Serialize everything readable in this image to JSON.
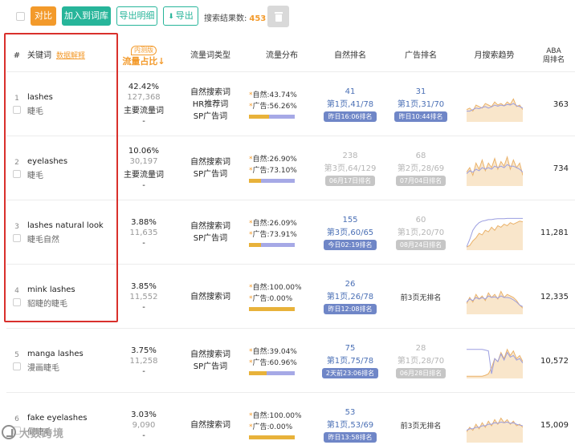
{
  "toolbar": {
    "compare_label": "对比",
    "add_label": "加入到词库",
    "export_detail_label": "导出明细",
    "export_label": "导出",
    "result_label": "搜索结果数:",
    "result_count": "453"
  },
  "header": {
    "num": "#",
    "keyword": "关键词",
    "data_explain": "数据解释",
    "share_badge": "内测版",
    "share_title": "流量占比↓",
    "type": "流量词类型",
    "dist": "流量分布",
    "natural_rank": "自然排名",
    "ad_rank": "广告排名",
    "trend": "月搜索趋势",
    "aba_line1": "ABA",
    "aba_line2": "周排名"
  },
  "labels": {
    "natural_prefix": "自然:",
    "ad_prefix": "广告:",
    "no_rank": "前3页无排名"
  },
  "colors": {
    "accent_orange": "#f39a2b",
    "accent_green": "#27b59a",
    "bar_natural": "#e8b23a",
    "bar_ad": "#a6a9e6",
    "rank_blue": "#4a6fb5",
    "highlight_red": "#d9302c"
  },
  "rows": [
    {
      "num": "1",
      "keyword": "lashes",
      "keyword_zh": "睫毛",
      "share_pct": "42.42%",
      "share_volume": "127,368",
      "share_tag": "主要流量词",
      "share_dash": "-",
      "types": [
        "自然搜索词",
        "HR推荐词",
        "SP广告词"
      ],
      "dist_natural": "43.74%",
      "dist_ad": "56.26%",
      "dist_natural_value": 43.74,
      "natural_rank": {
        "style": "blue",
        "num": "41",
        "page": "第1页,41/78",
        "badge": "昨日16:06排名"
      },
      "ad_rank": {
        "style": "blue",
        "num": "31",
        "page": "第1页,31/70",
        "badge": "昨日10:44排名"
      },
      "trend": [
        0.35,
        0.4,
        0.3,
        0.5,
        0.45,
        0.4,
        0.55,
        0.5,
        0.45,
        0.6,
        0.5,
        0.55,
        0.48,
        0.6,
        0.52,
        0.7,
        0.45,
        0.5,
        0.35
      ],
      "trend2": [
        0.3,
        0.3,
        0.35,
        0.4,
        0.38,
        0.42,
        0.45,
        0.4,
        0.44,
        0.5,
        0.46,
        0.5,
        0.47,
        0.52,
        0.5,
        0.55,
        0.48,
        0.45,
        0.4
      ],
      "aba": "363"
    },
    {
      "num": "2",
      "keyword": "eyelashes",
      "keyword_zh": "睫毛",
      "share_pct": "10.06%",
      "share_volume": "30,197",
      "share_tag": "主要流量词",
      "share_dash": "-",
      "types": [
        "自然搜索词",
        "SP广告词"
      ],
      "dist_natural": "26.90%",
      "dist_ad": "73.10%",
      "dist_natural_value": 26.9,
      "natural_rank": {
        "style": "grey",
        "num": "238",
        "page": "第3页,64/129",
        "badge": "06月17日排名"
      },
      "ad_rank": {
        "style": "grey",
        "num": "68",
        "page": "第2页,28/69",
        "badge": "07月04日排名"
      },
      "trend": [
        0.4,
        0.55,
        0.3,
        0.7,
        0.5,
        0.8,
        0.45,
        0.7,
        0.55,
        0.85,
        0.5,
        0.75,
        0.6,
        0.9,
        0.5,
        0.8,
        0.55,
        0.7,
        0.3
      ],
      "trend2": [
        0.35,
        0.45,
        0.4,
        0.5,
        0.45,
        0.55,
        0.5,
        0.55,
        0.5,
        0.6,
        0.55,
        0.6,
        0.55,
        0.65,
        0.6,
        0.6,
        0.55,
        0.5,
        0.4
      ],
      "aba": "734"
    },
    {
      "num": "3",
      "keyword": "lashes natural look",
      "keyword_zh": "睫毛自然",
      "share_pct": "3.88%",
      "share_volume": "11,635",
      "share_tag": "",
      "share_dash": "-",
      "types": [
        "自然搜索词",
        "SP广告词"
      ],
      "dist_natural": "26.09%",
      "dist_ad": "73.91%",
      "dist_natural_value": 26.09,
      "natural_rank": {
        "style": "blue",
        "num": "155",
        "page": "第3页,60/65",
        "badge": "今日02:19排名"
      },
      "ad_rank": {
        "style": "grey",
        "num": "60",
        "page": "第1页,20/70",
        "badge": "08月24日排名"
      },
      "trend": [
        0.05,
        0.1,
        0.25,
        0.35,
        0.5,
        0.45,
        0.6,
        0.55,
        0.7,
        0.6,
        0.75,
        0.7,
        0.8,
        0.75,
        0.85,
        0.8,
        0.85,
        0.9,
        0.88
      ],
      "trend2": [
        0.05,
        0.3,
        0.6,
        0.75,
        0.85,
        0.9,
        0.92,
        0.95,
        0.95,
        0.97,
        0.98,
        0.98,
        0.98,
        0.99,
        0.99,
        0.99,
        0.99,
        0.99,
        0.99
      ],
      "aba": "11,281"
    },
    {
      "num": "4",
      "keyword": "mink lashes",
      "keyword_zh": "貂睫的睫毛",
      "share_pct": "3.85%",
      "share_volume": "11,552",
      "share_tag": "",
      "share_dash": "-",
      "types": [
        "自然搜索词"
      ],
      "dist_natural": "100.00%",
      "dist_ad": "0.00%",
      "dist_natural_value": 100,
      "natural_rank": {
        "style": "blue",
        "num": "26",
        "page": "第1页,26/78",
        "badge": "昨日12:08排名"
      },
      "ad_rank": {
        "style": "none",
        "text": "前3页无排名"
      },
      "trend": [
        0.3,
        0.5,
        0.35,
        0.6,
        0.45,
        0.55,
        0.4,
        0.65,
        0.5,
        0.6,
        0.45,
        0.7,
        0.5,
        0.6,
        0.55,
        0.5,
        0.4,
        0.25,
        0.15
      ],
      "trend2": [
        0.35,
        0.45,
        0.4,
        0.5,
        0.45,
        0.5,
        0.45,
        0.55,
        0.5,
        0.52,
        0.48,
        0.55,
        0.5,
        0.5,
        0.48,
        0.42,
        0.35,
        0.25,
        0.2
      ],
      "aba": "12,335"
    },
    {
      "num": "5",
      "keyword": "manga lashes",
      "keyword_zh": "漫画睫毛",
      "share_pct": "3.75%",
      "share_volume": "11,258",
      "share_tag": "",
      "share_dash": "-",
      "types": [
        "自然搜索词",
        "SP广告词"
      ],
      "dist_natural": "39.04%",
      "dist_ad": "60.96%",
      "dist_natural_value": 39.04,
      "natural_rank": {
        "style": "blue",
        "num": "75",
        "page": "第1页,75/78",
        "badge": "2天前23:06排名"
      },
      "ad_rank": {
        "style": "grey",
        "num": "28",
        "page": "第1页,28/70",
        "badge": "06月28日排名"
      },
      "trend": [
        0.02,
        0.02,
        0.02,
        0.02,
        0.02,
        0.02,
        0.05,
        0.1,
        0.3,
        0.6,
        0.5,
        0.8,
        0.6,
        0.9,
        0.7,
        0.85,
        0.6,
        0.7,
        0.5
      ],
      "trend2": [
        0.9,
        0.9,
        0.9,
        0.9,
        0.9,
        0.9,
        0.88,
        0.85,
        0.1,
        0.6,
        0.5,
        0.75,
        0.55,
        0.8,
        0.65,
        0.7,
        0.55,
        0.6,
        0.45
      ],
      "aba": "10,572"
    },
    {
      "num": "6",
      "keyword": "fake eyelashes",
      "keyword_zh": "假睫毛",
      "share_pct": "3.03%",
      "share_volume": "9,090",
      "share_tag": "",
      "share_dash": "-",
      "types": [
        "自然搜索词"
      ],
      "dist_natural": "100.00%",
      "dist_ad": "0.00%",
      "dist_natural_value": 100,
      "natural_rank": {
        "style": "blue",
        "num": "53",
        "page": "第1页,53/69",
        "badge": "昨日13:58排名"
      },
      "ad_rank": {
        "style": "none",
        "text": "前3页无排名"
      },
      "trend": [
        0.3,
        0.45,
        0.35,
        0.55,
        0.4,
        0.6,
        0.45,
        0.65,
        0.5,
        0.7,
        0.55,
        0.75,
        0.6,
        0.7,
        0.55,
        0.65,
        0.5,
        0.55,
        0.45
      ],
      "trend2": [
        0.35,
        0.4,
        0.4,
        0.45,
        0.45,
        0.5,
        0.5,
        0.55,
        0.55,
        0.6,
        0.58,
        0.62,
        0.6,
        0.62,
        0.58,
        0.6,
        0.55,
        0.52,
        0.5
      ],
      "aba": "15,009"
    }
  ],
  "watermark": {
    "text": "大数跨境"
  }
}
